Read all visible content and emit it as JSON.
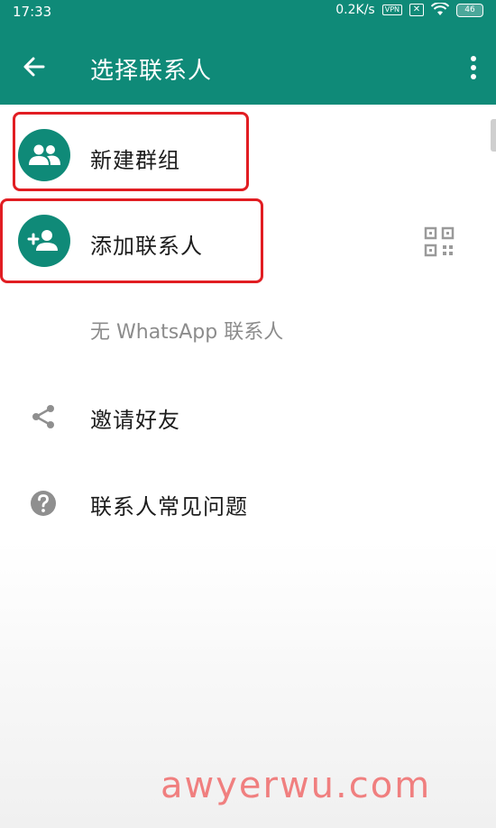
{
  "status_bar": {
    "time": "17:33",
    "speed": "0.2K/s",
    "vpn": "VPN",
    "battery": "46"
  },
  "app_bar": {
    "title": "选择联系人",
    "back_icon": "arrow-back-icon",
    "menu_icon": "more-vert-icon"
  },
  "actions": [
    {
      "label": "新建群组",
      "icon": "group-icon"
    },
    {
      "label": "添加联系人",
      "icon": "add-person-icon",
      "trailing_icon": "qr-code-icon"
    }
  ],
  "empty_state": "无 WhatsApp 联系人",
  "links": [
    {
      "label": "邀请好友",
      "icon": "share-icon"
    },
    {
      "label": "联系人常见问题",
      "icon": "help-icon"
    }
  ],
  "watermark": "awyerwu.com",
  "colors": {
    "primary": "#0f8a78",
    "highlight": "#e11d22",
    "watermark": "#f07f7f"
  }
}
